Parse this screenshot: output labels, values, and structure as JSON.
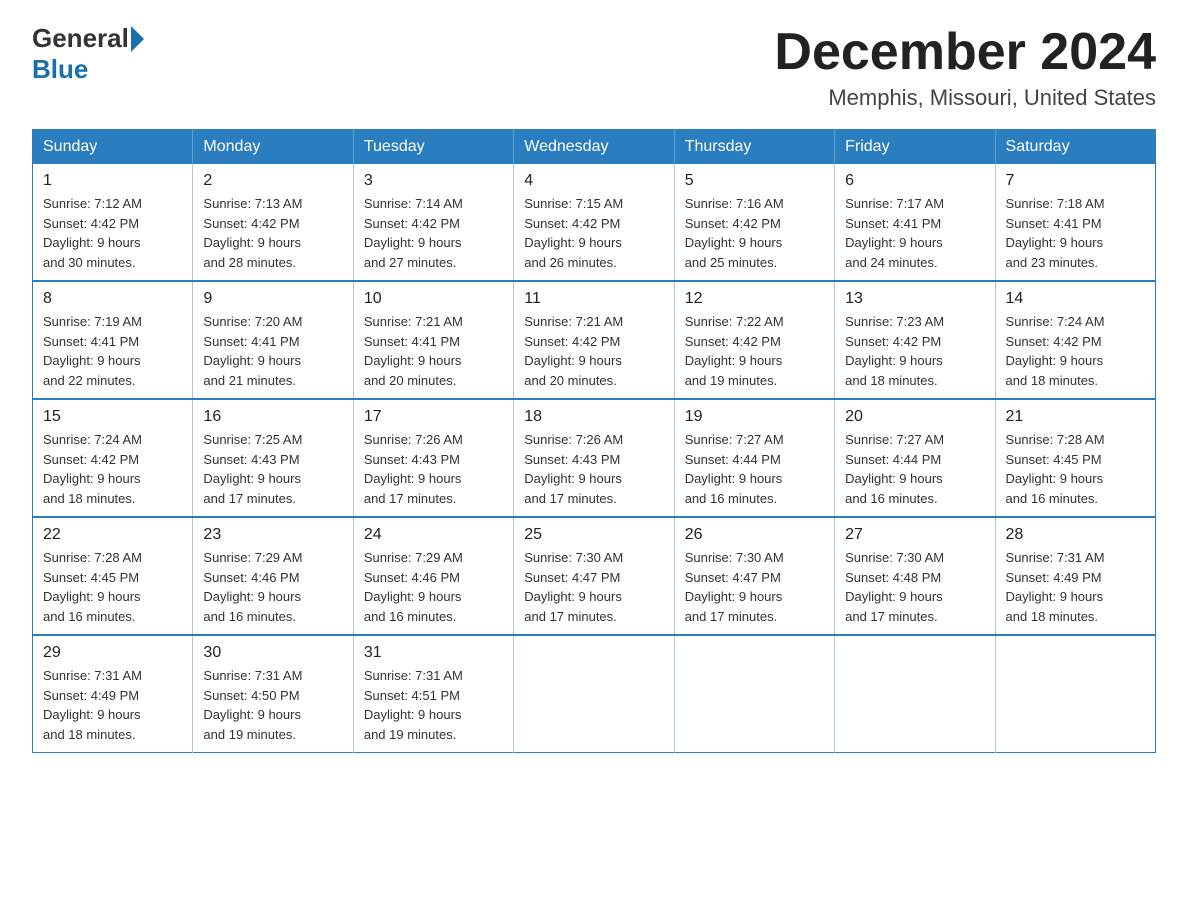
{
  "logo": {
    "general": "General",
    "blue": "Blue",
    "triangle": "▶"
  },
  "header": {
    "month": "December 2024",
    "location": "Memphis, Missouri, United States"
  },
  "days_of_week": [
    "Sunday",
    "Monday",
    "Tuesday",
    "Wednesday",
    "Thursday",
    "Friday",
    "Saturday"
  ],
  "weeks": [
    [
      {
        "day": "1",
        "sunrise": "7:12 AM",
        "sunset": "4:42 PM",
        "daylight": "9 hours and 30 minutes."
      },
      {
        "day": "2",
        "sunrise": "7:13 AM",
        "sunset": "4:42 PM",
        "daylight": "9 hours and 28 minutes."
      },
      {
        "day": "3",
        "sunrise": "7:14 AM",
        "sunset": "4:42 PM",
        "daylight": "9 hours and 27 minutes."
      },
      {
        "day": "4",
        "sunrise": "7:15 AM",
        "sunset": "4:42 PM",
        "daylight": "9 hours and 26 minutes."
      },
      {
        "day": "5",
        "sunrise": "7:16 AM",
        "sunset": "4:42 PM",
        "daylight": "9 hours and 25 minutes."
      },
      {
        "day": "6",
        "sunrise": "7:17 AM",
        "sunset": "4:41 PM",
        "daylight": "9 hours and 24 minutes."
      },
      {
        "day": "7",
        "sunrise": "7:18 AM",
        "sunset": "4:41 PM",
        "daylight": "9 hours and 23 minutes."
      }
    ],
    [
      {
        "day": "8",
        "sunrise": "7:19 AM",
        "sunset": "4:41 PM",
        "daylight": "9 hours and 22 minutes."
      },
      {
        "day": "9",
        "sunrise": "7:20 AM",
        "sunset": "4:41 PM",
        "daylight": "9 hours and 21 minutes."
      },
      {
        "day": "10",
        "sunrise": "7:21 AM",
        "sunset": "4:41 PM",
        "daylight": "9 hours and 20 minutes."
      },
      {
        "day": "11",
        "sunrise": "7:21 AM",
        "sunset": "4:42 PM",
        "daylight": "9 hours and 20 minutes."
      },
      {
        "day": "12",
        "sunrise": "7:22 AM",
        "sunset": "4:42 PM",
        "daylight": "9 hours and 19 minutes."
      },
      {
        "day": "13",
        "sunrise": "7:23 AM",
        "sunset": "4:42 PM",
        "daylight": "9 hours and 18 minutes."
      },
      {
        "day": "14",
        "sunrise": "7:24 AM",
        "sunset": "4:42 PM",
        "daylight": "9 hours and 18 minutes."
      }
    ],
    [
      {
        "day": "15",
        "sunrise": "7:24 AM",
        "sunset": "4:42 PM",
        "daylight": "9 hours and 18 minutes."
      },
      {
        "day": "16",
        "sunrise": "7:25 AM",
        "sunset": "4:43 PM",
        "daylight": "9 hours and 17 minutes."
      },
      {
        "day": "17",
        "sunrise": "7:26 AM",
        "sunset": "4:43 PM",
        "daylight": "9 hours and 17 minutes."
      },
      {
        "day": "18",
        "sunrise": "7:26 AM",
        "sunset": "4:43 PM",
        "daylight": "9 hours and 17 minutes."
      },
      {
        "day": "19",
        "sunrise": "7:27 AM",
        "sunset": "4:44 PM",
        "daylight": "9 hours and 16 minutes."
      },
      {
        "day": "20",
        "sunrise": "7:27 AM",
        "sunset": "4:44 PM",
        "daylight": "9 hours and 16 minutes."
      },
      {
        "day": "21",
        "sunrise": "7:28 AM",
        "sunset": "4:45 PM",
        "daylight": "9 hours and 16 minutes."
      }
    ],
    [
      {
        "day": "22",
        "sunrise": "7:28 AM",
        "sunset": "4:45 PM",
        "daylight": "9 hours and 16 minutes."
      },
      {
        "day": "23",
        "sunrise": "7:29 AM",
        "sunset": "4:46 PM",
        "daylight": "9 hours and 16 minutes."
      },
      {
        "day": "24",
        "sunrise": "7:29 AM",
        "sunset": "4:46 PM",
        "daylight": "9 hours and 16 minutes."
      },
      {
        "day": "25",
        "sunrise": "7:30 AM",
        "sunset": "4:47 PM",
        "daylight": "9 hours and 17 minutes."
      },
      {
        "day": "26",
        "sunrise": "7:30 AM",
        "sunset": "4:47 PM",
        "daylight": "9 hours and 17 minutes."
      },
      {
        "day": "27",
        "sunrise": "7:30 AM",
        "sunset": "4:48 PM",
        "daylight": "9 hours and 17 minutes."
      },
      {
        "day": "28",
        "sunrise": "7:31 AM",
        "sunset": "4:49 PM",
        "daylight": "9 hours and 18 minutes."
      }
    ],
    [
      {
        "day": "29",
        "sunrise": "7:31 AM",
        "sunset": "4:49 PM",
        "daylight": "9 hours and 18 minutes."
      },
      {
        "day": "30",
        "sunrise": "7:31 AM",
        "sunset": "4:50 PM",
        "daylight": "9 hours and 19 minutes."
      },
      {
        "day": "31",
        "sunrise": "7:31 AM",
        "sunset": "4:51 PM",
        "daylight": "9 hours and 19 minutes."
      },
      null,
      null,
      null,
      null
    ]
  ]
}
